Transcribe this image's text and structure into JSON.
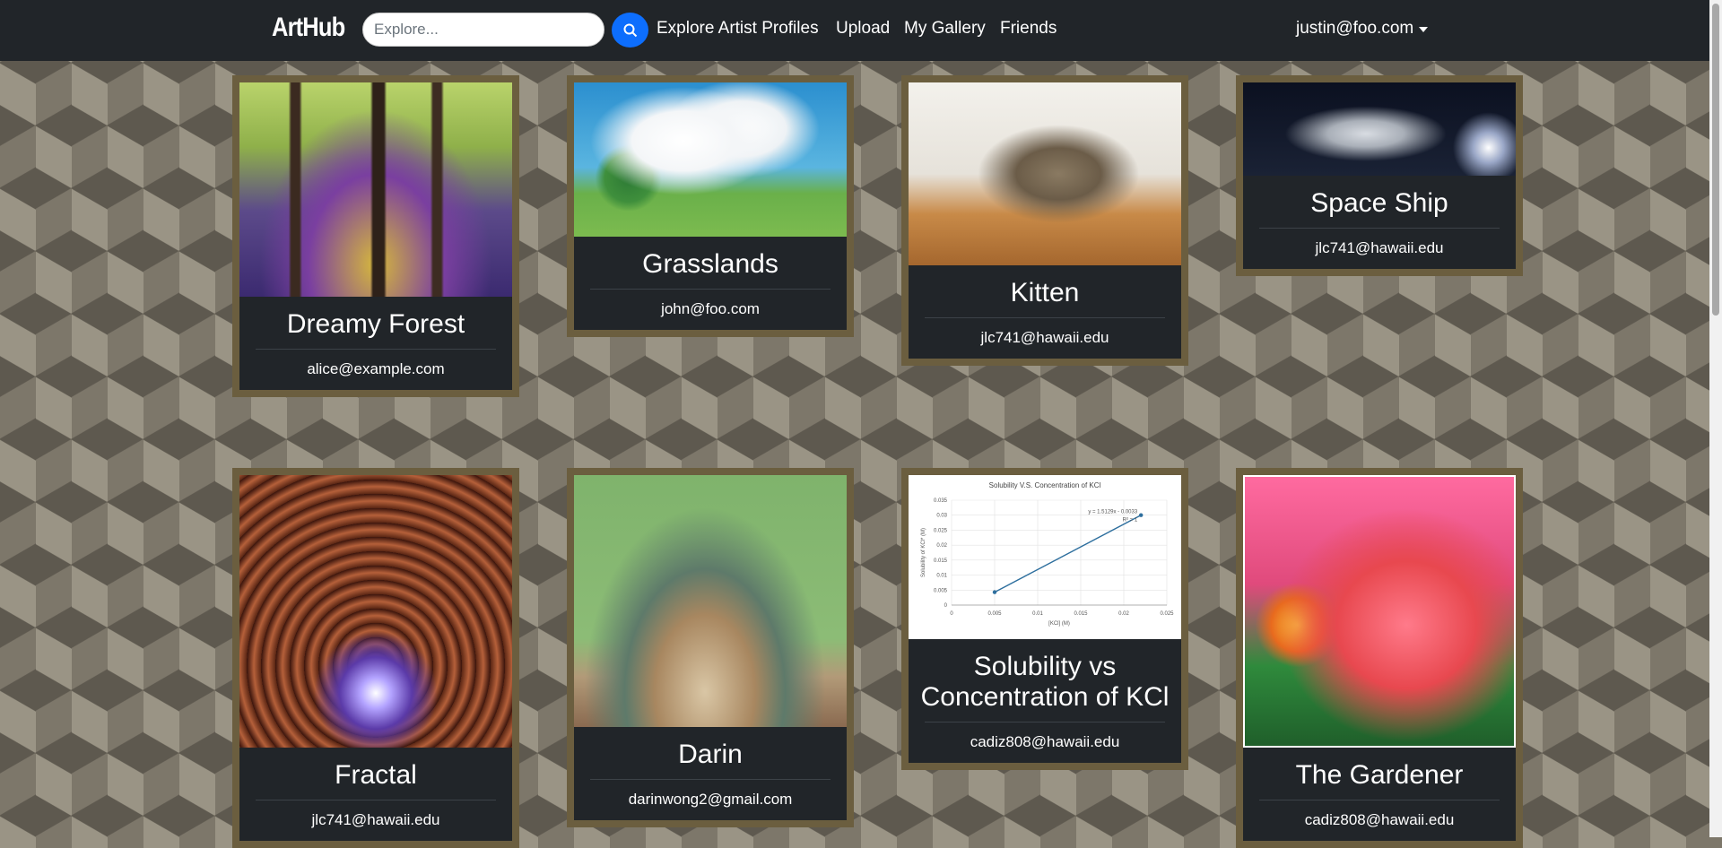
{
  "navbar": {
    "brand": "ArtHub",
    "search_placeholder": "Explore...",
    "links": [
      "Explore Artist Profiles",
      "Upload",
      "My Gallery",
      "Friends"
    ],
    "user": "justin@foo.com"
  },
  "cards": [
    {
      "title": "Dreamy Forest",
      "owner": "alice@example.com"
    },
    {
      "title": "Grasslands",
      "owner": "john@foo.com"
    },
    {
      "title": "Kitten",
      "owner": "jlc741@hawaii.edu"
    },
    {
      "title": "Space Ship",
      "owner": "jlc741@hawaii.edu"
    },
    {
      "title": "Fractal",
      "owner": "jlc741@hawaii.edu"
    },
    {
      "title": "Darin",
      "owner": "darinwong2@gmail.com"
    },
    {
      "title": "Solubility vs Concentration of KCl",
      "owner": "cadiz808@hawaii.edu"
    },
    {
      "title": "The Gardener",
      "owner": "cadiz808@hawaii.edu"
    }
  ],
  "thumbnail_chart": {
    "title": "Solubility V.S. Concentration of KCl",
    "xlabel": "[KCl] (M)",
    "ylabel": "Solubility of KCl* (M)",
    "equation": "y = 1.5129x - 0.0033",
    "r2": "R² = 1",
    "x_ticks": [
      "0",
      "0.005",
      "0.01",
      "0.015",
      "0.02",
      "0.025"
    ],
    "y_ticks": [
      "0",
      "0.005",
      "0.01",
      "0.015",
      "0.02",
      "0.025",
      "0.03",
      "0.035"
    ],
    "points": [
      [
        0.005,
        0.0043
      ],
      [
        0.022,
        0.03
      ]
    ],
    "xlim": [
      0,
      0.025
    ],
    "ylim": [
      0,
      0.035
    ]
  }
}
